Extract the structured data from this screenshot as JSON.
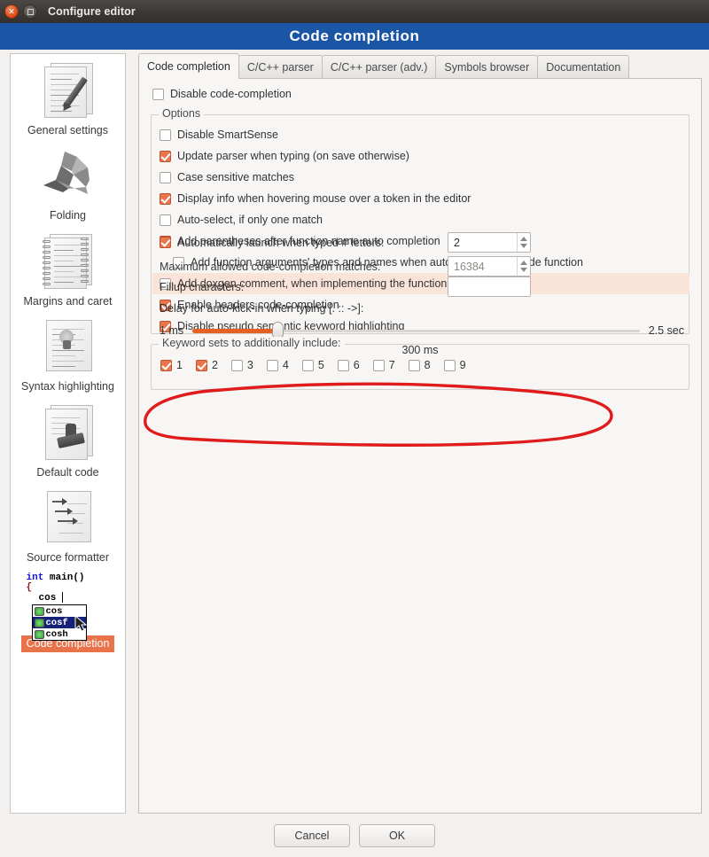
{
  "window": {
    "title": "Configure editor",
    "close_icon": "close-icon",
    "maximize_icon": "maximize-icon"
  },
  "header": {
    "title": "Code completion",
    "bg_color": "#1b55a6"
  },
  "sidebar": {
    "items": [
      {
        "label": "General settings",
        "icon": "documents-pencil-icon",
        "selected": false
      },
      {
        "label": "Folding",
        "icon": "origami-bird-icon",
        "selected": false
      },
      {
        "label": "Margins and caret",
        "icon": "spiral-notebook-icon",
        "selected": false
      },
      {
        "label": "Syntax highlighting",
        "icon": "highlighted-document-icon",
        "selected": false
      },
      {
        "label": "Default code",
        "icon": "stamp-document-icon",
        "selected": false
      },
      {
        "label": "Source formatter",
        "icon": "arrows-document-icon",
        "selected": false
      },
      {
        "label": "Code completion",
        "icon": "code-completion-popup-icon",
        "selected": true
      }
    ],
    "code_icon": {
      "line1_kw": "int",
      "line1_fn": " main()",
      "line2": "{",
      "line3": "cos",
      "popup_items": [
        "cos",
        "cosf",
        "cosh"
      ],
      "popup_selected": "cosf"
    }
  },
  "tabs": [
    {
      "label": "Code completion",
      "active": true
    },
    {
      "label": "C/C++ parser",
      "active": false
    },
    {
      "label": "C/C++ parser (adv.)",
      "active": false
    },
    {
      "label": "Symbols browser",
      "active": false
    },
    {
      "label": "Documentation",
      "active": false
    }
  ],
  "main": {
    "disable_code_completion": {
      "label": "Disable code-completion",
      "checked": false
    },
    "options_legend": "Options",
    "options": [
      {
        "label": "Disable SmartSense",
        "checked": false,
        "indent": false,
        "highlight": false
      },
      {
        "label": "Update parser when typing (on save otherwise)",
        "checked": true,
        "indent": false,
        "highlight": false
      },
      {
        "label": "Case sensitive matches",
        "checked": false,
        "indent": false,
        "highlight": false
      },
      {
        "label": "Display info when hovering mouse over a token in the editor",
        "checked": true,
        "indent": false,
        "highlight": false
      },
      {
        "label": "Auto-select, if only one match",
        "checked": false,
        "indent": false,
        "highlight": false
      },
      {
        "label": "Add parentheses after function name auto completion",
        "checked": true,
        "indent": false,
        "highlight": false
      },
      {
        "label": "Add function arguments' types and names when autocompleted outside function",
        "checked": false,
        "indent": true,
        "highlight": false
      },
      {
        "label": "Add doxgen comment, when implementing the function method",
        "checked": false,
        "indent": false,
        "highlight": true
      },
      {
        "label": "Enable headers code-completion",
        "checked": true,
        "indent": false,
        "highlight": false
      },
      {
        "label": "Disable pseudo semantic keyword highlighting",
        "checked": true,
        "indent": false,
        "highlight": false
      }
    ],
    "auto_launch": {
      "label": "Automatically launch when typed # letters:",
      "checked": true,
      "value": "2"
    },
    "max_matches": {
      "label": "Maximum allowed code-completion matches:",
      "value": "16384",
      "disabled": true
    },
    "fillup": {
      "label": "Fillup characters:",
      "value": "",
      "placeholder": ""
    },
    "delay": {
      "label": "Delay for auto-kick-in when typing [. :: ->]:",
      "min_label": "1 ms",
      "max_label": "2.5 sec",
      "value_label": "300 ms",
      "fill_percent": 19
    },
    "keyword_sets": {
      "legend": "Keyword sets to additionally include:",
      "items": [
        {
          "label": "1",
          "checked": true
        },
        {
          "label": "2",
          "checked": true
        },
        {
          "label": "3",
          "checked": false
        },
        {
          "label": "4",
          "checked": false
        },
        {
          "label": "5",
          "checked": false
        },
        {
          "label": "6",
          "checked": false
        },
        {
          "label": "7",
          "checked": false
        },
        {
          "label": "8",
          "checked": false
        },
        {
          "label": "9",
          "checked": false
        }
      ]
    }
  },
  "footer": {
    "cancel_label": "Cancel",
    "ok_label": "OK"
  },
  "annotation": {
    "type": "hand-drawn-ellipse",
    "color": "#e01b1b",
    "targets": "auto-launch-row"
  },
  "colors": {
    "accent_orange": "#e8764f",
    "header_blue": "#1b55a6",
    "highlight_row": "#fae3d8",
    "annotation_red": "#e01b1b",
    "selected_label": "#e8734a"
  }
}
